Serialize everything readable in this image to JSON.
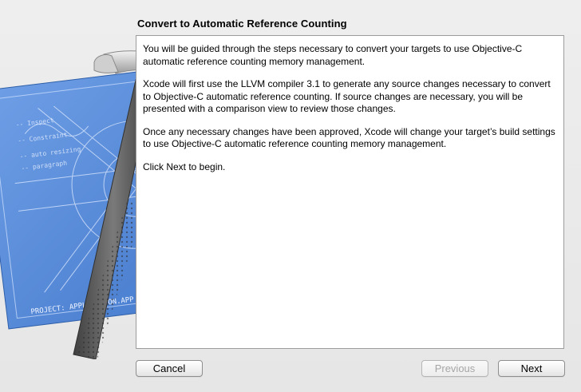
{
  "dialog": {
    "title": "Convert to Automatic Reference Counting",
    "paragraphs": [
      "You will be guided through the steps necessary to convert your targets to use Objective-C automatic reference counting memory management.",
      "Xcode will first use the LLVM compiler 3.1 to generate any source changes necessary to convert to Objective-C automatic reference counting. If source changes are necessary, you will be presented with a comparison view to review those changes.",
      "Once any necessary changes have been approved, Xcode will change your target’s build settings to use Objective-C automatic reference counting memory management.",
      "Click Next to begin."
    ]
  },
  "artwork": {
    "icon": "xcode-blueprint-hammer-icon",
    "blueprint_text": "PROJECT: APPLICATION.APP",
    "colors": {
      "blueprint": "#4f86d8",
      "hammer_handle": "#5c5c5c",
      "hammer_head": "#bdbdbd"
    }
  },
  "buttons": {
    "cancel": "Cancel",
    "previous": "Previous",
    "next": "Next"
  }
}
